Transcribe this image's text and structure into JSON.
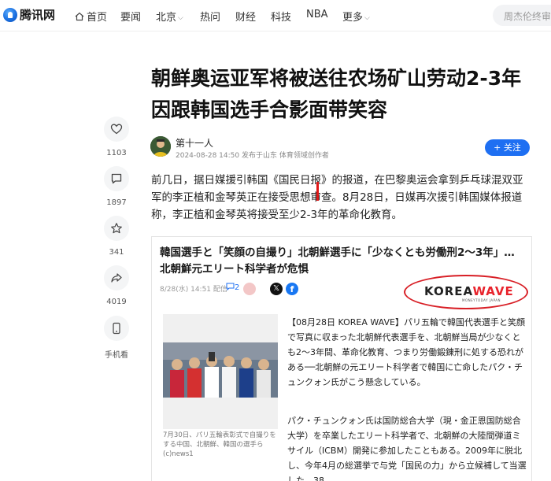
{
  "nav": {
    "logo": "腾讯网",
    "home": "首页",
    "items": [
      "要闻",
      "北京",
      "热问",
      "财经",
      "科技",
      "NBA",
      "更多"
    ],
    "search_placeholder": "周杰伦终审"
  },
  "article": {
    "title_line1": "朝鲜奥运亚军将被送往农场矿山劳动2-3年",
    "title_line2": "因跟韩国选手合影面带笑容",
    "author": "第十一人",
    "meta": "2024-08-28 14:50 发布于山东 体育领域创作者",
    "follow": "+ 关注",
    "paragraph": "前几日，据日媒援引韩国《国民日报》的报道，在巴黎奥运会拿到乒乓球混双亚军的李正植和金琴英正在接受思想审查。8月28日，日媒再次援引韩国媒体报道称，李正植和金琴英将接受至少2-3年的革命化教育。"
  },
  "rail": {
    "like_count": "1103",
    "comment_count": "1897",
    "favorite_count": "341",
    "share_count": "4019",
    "mobile_label": "手机看"
  },
  "embed": {
    "title_line1": "韓国選手と「笑顔の自撮り」北朝鮮選手に「少なくとも労働刑2〜3年」…",
    "title_line2": "北朝鮮元エリート科学者が危惧",
    "meta": "8/28(水) 14:51 配信",
    "comment_count": "2",
    "logo_korea": "KOREA",
    "logo_wave": "WAVE",
    "logo_sub": "MONEYTODAY JAPAN",
    "photo_caption": "7月30日、パリ五輪表彰式で自撮りをする中国、北朝鮮、韓国の選手ら(c)news1",
    "body1": "【08月28日 KOREA WAVE】パリ五輪で韓国代表選手と笑顔で写真に収まった北朝鮮代表選手を、北朝鮮当局が少なくとも2〜3年間、革命化教育、つまり労働鍛錬刑に処する恐れがある──北朝鮮の元エリート科学者で韓国に亡命したパク・チュンクォン氏がこう懸念している。",
    "body2": "パク・チュンクォン氏は国防総合大学（現・金正恩国防総合大学）を卒業したエリート科学者で、北朝鮮の大陸間弾道ミサイル（ICBM）開発に参加したこともある。2009年に脱北し、今年4月の総選挙で与党「国民の力」から立候補して当選した。38"
  },
  "colors": {
    "accent": "#1e6ff2",
    "highlight_mark": "#e01818",
    "badge_red": "#d81f26"
  }
}
